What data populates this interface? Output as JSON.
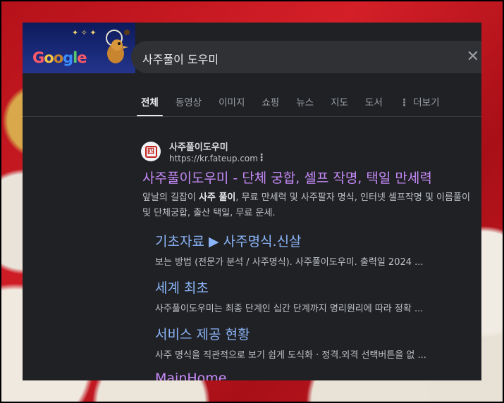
{
  "search": {
    "query": "사주풀이 도우미"
  },
  "doodle": {
    "logo_text": "Google"
  },
  "tabs": [
    {
      "label": "전체"
    },
    {
      "label": "동영상"
    },
    {
      "label": "이미지"
    },
    {
      "label": "쇼핑"
    },
    {
      "label": "뉴스"
    },
    {
      "label": "지도"
    },
    {
      "label": "도서"
    },
    {
      "label": "더보기"
    }
  ],
  "result": {
    "site_name": "사주풀이도우미",
    "url": "https://kr.fateup.com",
    "favicon_char": "四",
    "title": "사주풀이도우미 - 단체 궁합, 셀프 작명, 택일 만세력",
    "snippet_pre": "앞날의 길잡이 ",
    "snippet_bold": "사주 풀이",
    "snippet_post": ", 무료 만세력 및 사주팔자 명식, 인터넷 셀프작명 및 이름풀이",
    "snippet_line2": "및 단체궁합, 출산 택일, 무료 운세."
  },
  "sitelinks": [
    {
      "title": "기초자료 ▶ 사주명식.신살",
      "desc": "보는 방법 (전문가 분석 / 사주명식). 사주풀이도우미. 출력일 2024 ..."
    },
    {
      "title": "세계 최초",
      "desc": "사주풀이도우미는 최종 단계인 십간 단계까지 명리원리에 따라 정확 ..."
    },
    {
      "title": "서비스 제공 현황",
      "desc": "사주 명식을 직관적으로 보기 쉽게 도식화 · 정격.외격 선택버튼을 없 ..."
    },
    {
      "title": "MainHome",
      "desc": ""
    }
  ],
  "colors": {
    "visited_link": "#c58af9",
    "link": "#8ab4f8",
    "panel_bg": "#202124"
  }
}
